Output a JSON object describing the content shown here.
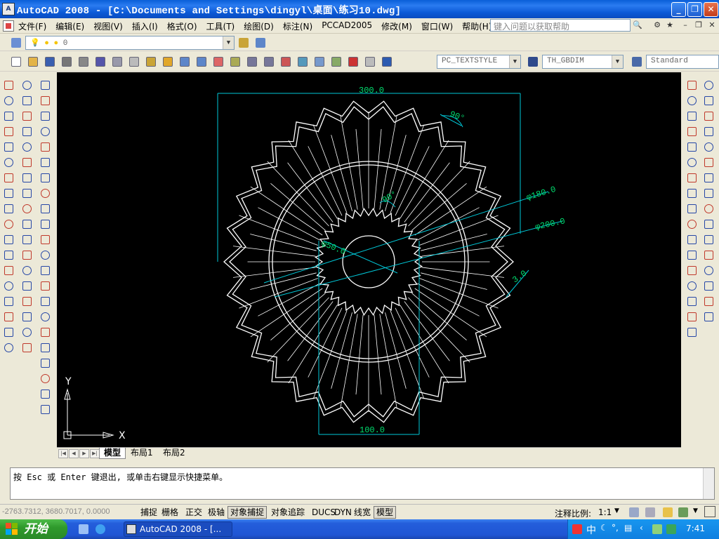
{
  "window": {
    "title": "AutoCAD 2008 - [C:\\Documents and Settings\\dingyl\\桌面\\练习10.dwg]",
    "app_icon_text": "A"
  },
  "menu": {
    "items": [
      "文件(F)",
      "编辑(E)",
      "视图(V)",
      "插入(I)",
      "格式(O)",
      "工具(T)",
      "绘图(D)",
      "标注(N)",
      "PCCAD2005",
      "修改(M)",
      "窗口(W)",
      "帮助(H)"
    ],
    "help_placeholder": "键入问题以获取帮助"
  },
  "layers": {
    "current_layer": "0"
  },
  "styles": {
    "text_style": "PC_TEXTSTYLE",
    "dim_style": "TH_GBDIM",
    "table_style": "Standard"
  },
  "drawing": {
    "dims": {
      "top": "300.0",
      "bottom": "100.0",
      "angle_outer": "90°",
      "angle_inner": "90°",
      "dia_180": "φ180.0",
      "dia_200": "φ200.0",
      "dia_50": "φ50.0",
      "thick": "3.0"
    },
    "ucs_x": "X",
    "ucs_y": "Y",
    "line_color": "#ffffff",
    "dim_color": "#00c8d8"
  },
  "layout_tabs": [
    "模型",
    "布局1",
    "布局2"
  ],
  "command": {
    "prompt": "按 Esc 或 Enter 键退出, 或单击右键显示快捷菜单。"
  },
  "status": {
    "coordinates": "-2763.7312, 3680.7017, 0.0000",
    "toggles": [
      "捕捉",
      "栅格",
      "正交",
      "极轴",
      "对象捕捉",
      "对象追踪",
      "DUCS",
      "DYN",
      "线宽",
      "模型"
    ],
    "annotation_scale_label": "注释比例:",
    "annotation_scale": "1:1"
  },
  "taskbar": {
    "start_label": "开始",
    "task_label": "AutoCAD 2008 - [...",
    "ime": "中",
    "clock": "7:41"
  }
}
